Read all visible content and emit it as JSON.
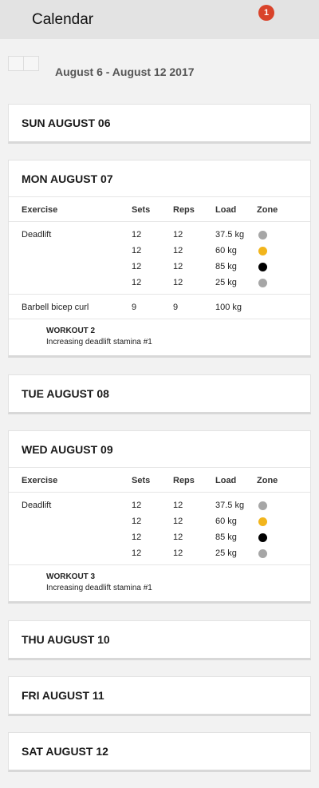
{
  "header": {
    "title": "Calendar",
    "notification_count": "1"
  },
  "week": {
    "range": "August 6 - August 12 2017"
  },
  "columns": {
    "exercise": "Exercise",
    "sets": "Sets",
    "reps": "Reps",
    "load": "Load",
    "zone": "Zone"
  },
  "colors": {
    "gray": "#a6a6a6",
    "yellow": "#f2b51c",
    "black": "#000000",
    "badge": "#d9432a"
  },
  "days": [
    {
      "label": "SUN AUGUST 06"
    },
    {
      "label": "MON AUGUST 07",
      "exercises": [
        {
          "name": "Deadlift",
          "sets": [
            {
              "sets": "12",
              "reps": "12",
              "load": "37.5 kg",
              "zone": "gray"
            },
            {
              "sets": "12",
              "reps": "12",
              "load": "60 kg",
              "zone": "yellow"
            },
            {
              "sets": "12",
              "reps": "12",
              "load": "85 kg",
              "zone": "black"
            },
            {
              "sets": "12",
              "reps": "12",
              "load": "25 kg",
              "zone": "gray"
            }
          ]
        },
        {
          "name": "Barbell bicep curl",
          "sets": [
            {
              "sets": "9",
              "reps": "9",
              "load": "100 kg",
              "zone": ""
            }
          ]
        }
      ],
      "workout": {
        "title": "WORKOUT 2",
        "subtitle": "Increasing deadlift stamina #1"
      }
    },
    {
      "label": "TUE AUGUST 08"
    },
    {
      "label": "WED AUGUST 09",
      "exercises": [
        {
          "name": "Deadlift",
          "sets": [
            {
              "sets": "12",
              "reps": "12",
              "load": "37.5 kg",
              "zone": "gray"
            },
            {
              "sets": "12",
              "reps": "12",
              "load": "60 kg",
              "zone": "yellow"
            },
            {
              "sets": "12",
              "reps": "12",
              "load": "85 kg",
              "zone": "black"
            },
            {
              "sets": "12",
              "reps": "12",
              "load": "25 kg",
              "zone": "gray"
            }
          ]
        }
      ],
      "workout": {
        "title": "WORKOUT 3",
        "subtitle": "Increasing deadlift stamina #1"
      }
    },
    {
      "label": "THU AUGUST 10"
    },
    {
      "label": "FRI AUGUST 11"
    },
    {
      "label": "SAT AUGUST 12"
    }
  ]
}
